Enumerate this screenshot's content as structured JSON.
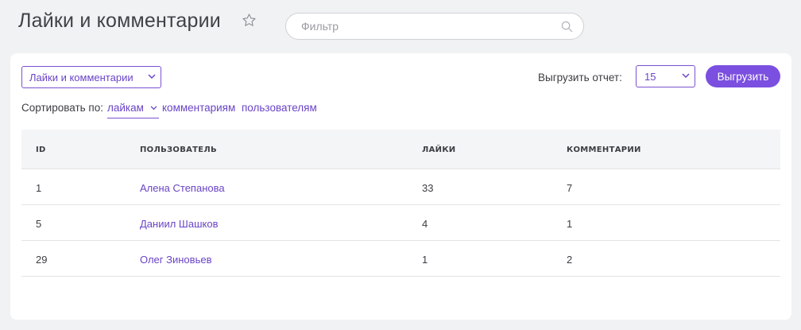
{
  "header": {
    "title": "Лайки и комментарии",
    "search_placeholder": "Фильтр"
  },
  "toolbar": {
    "report_type": "Лайки и комментарии",
    "export_label": "Выгрузить отчет:",
    "export_count": "15",
    "export_button": "Выгрузить"
  },
  "sort": {
    "label": "Сортировать по:",
    "active": "лайкам",
    "options": [
      "комментариям",
      "пользователям"
    ]
  },
  "table": {
    "columns": [
      "ID",
      "ПОЛЬЗОВАТЕЛЬ",
      "ЛАЙКИ",
      "КОММЕНТАРИИ"
    ],
    "rows": [
      {
        "id": "1",
        "user": "Алена Степанова",
        "likes": "33",
        "comments": "7"
      },
      {
        "id": "5",
        "user": "Даниил Шашков",
        "likes": "4",
        "comments": "1"
      },
      {
        "id": "29",
        "user": "Олег Зиновьев",
        "likes": "1",
        "comments": "2"
      }
    ]
  },
  "colors": {
    "accent": "#7b4fe0",
    "link": "#6a44c7",
    "background": "#f1f2f4"
  },
  "icons": [
    "star-outline-icon",
    "search-icon",
    "chevron-down-icon"
  ]
}
